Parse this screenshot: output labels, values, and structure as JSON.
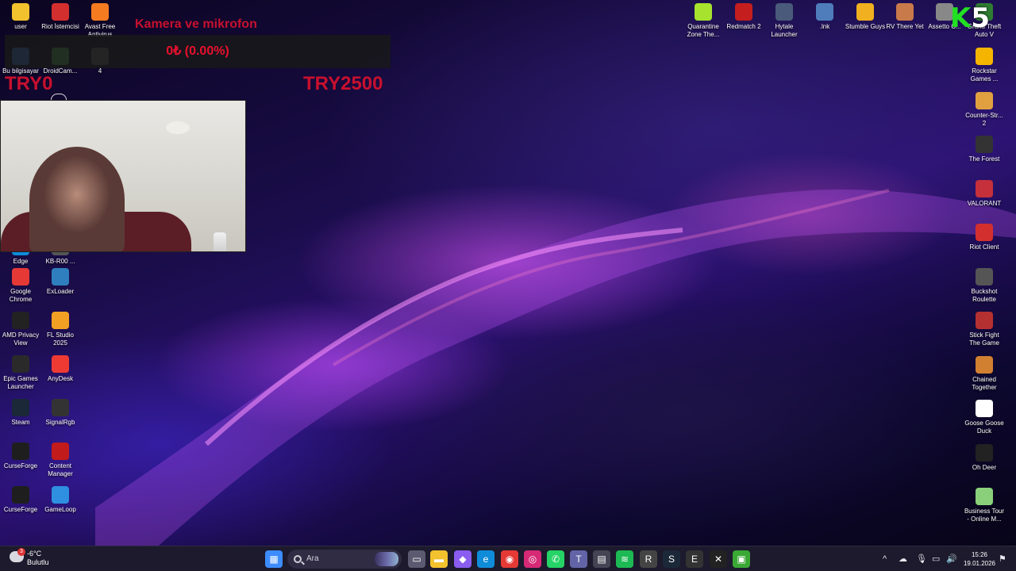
{
  "overlay": {
    "title": "Kamera ve mikrofon",
    "amount": "0₺ (0.00%)",
    "left_value": "TRY0",
    "right_value": "TRY2500"
  },
  "brand_badge": {
    "k": "K",
    "n": "5"
  },
  "desktop_left": [
    {
      "label": "user",
      "icon": "folder-icon",
      "color": "#f2c12e"
    },
    {
      "label": "Riot İstemcisi",
      "icon": "riot-icon",
      "color": "#d32f2f"
    },
    {
      "label": "Avast Free Antivirus",
      "icon": "avast-icon",
      "color": "#f47b20"
    },
    {
      "label": "Bu bilgisayar",
      "icon": "computer-icon",
      "color": "#3a7bd5"
    },
    {
      "label": "DroidCam...",
      "icon": "droidcam-icon",
      "color": "#4caf50"
    },
    {
      "label": "4",
      "icon": "unknown-icon",
      "color": "#666666"
    },
    {
      "label": "Edge",
      "icon": "edge-icon",
      "color": "#0f8cd9"
    },
    {
      "label": "KB-R00 ...",
      "icon": "app-icon",
      "color": "#555555"
    },
    {
      "label": "Google Chrome",
      "icon": "chrome-icon",
      "color": "#e53935"
    },
    {
      "label": "ExLoader",
      "icon": "exloader-icon",
      "color": "#2f7fbf"
    },
    {
      "label": "AMD Privacy View",
      "icon": "amd-icon",
      "color": "#222222"
    },
    {
      "label": "FL Studio 2025",
      "icon": "flstudio-icon",
      "color": "#f2a024"
    },
    {
      "label": "Epic Games Launcher",
      "icon": "epic-icon",
      "color": "#2a2a2a"
    },
    {
      "label": "AnyDesk",
      "icon": "anydesk-icon",
      "color": "#ef3a33"
    },
    {
      "label": "Steam",
      "icon": "steam-icon",
      "color": "#1b2838"
    },
    {
      "label": "SignalRgb",
      "icon": "signalrgb-icon",
      "color": "#333333"
    },
    {
      "label": "CurseForge",
      "icon": "curseforge-icon",
      "color": "#1e1e1e"
    },
    {
      "label": "Content Manager",
      "icon": "content-manager-icon",
      "color": "#c21b1b"
    },
    {
      "label": "CurseForge",
      "icon": "curseforge-icon",
      "color": "#1e1e1e"
    },
    {
      "label": "GameLoop",
      "icon": "gameloop-icon",
      "color": "#2f8fe0"
    }
  ],
  "desktop_top_right": [
    {
      "label": "Quarantine Zone The...",
      "icon": "quarantine-icon",
      "color": "#a6e22e"
    },
    {
      "label": "Redmatch 2",
      "icon": "redmatch-icon",
      "color": "#c41e1e"
    },
    {
      "label": "Hytale Launcher",
      "icon": "hytale-icon",
      "color": "#4a5a7a"
    },
    {
      "label": ".lnk",
      "icon": "shortcut-icon",
      "color": "#4f7dbb"
    },
    {
      "label": "Stumble Guys",
      "icon": "stumble-icon",
      "color": "#f0b020"
    },
    {
      "label": "RV There Yet",
      "icon": "rv-icon",
      "color": "#c87a4a"
    },
    {
      "label": "Assetto C...",
      "icon": "assetto-icon",
      "color": "#888888"
    },
    {
      "label": "Grand Theft Auto V",
      "icon": "gta-icon",
      "color": "#2e7d32"
    }
  ],
  "desktop_right": [
    {
      "label": "Rockstar Games ...",
      "icon": "rockstar-icon",
      "color": "#f5b400"
    },
    {
      "label": "Counter-Str... 2",
      "icon": "cs2-icon",
      "color": "#e0a040"
    },
    {
      "label": "The Forest",
      "icon": "forest-icon",
      "color": "#333333"
    },
    {
      "label": "VALORANT",
      "icon": "valorant-icon",
      "color": "#c5303b"
    },
    {
      "label": "Riot Client",
      "icon": "riot-icon",
      "color": "#d32f2f"
    },
    {
      "label": "Buckshot Roulette",
      "icon": "buckshot-icon",
      "color": "#555555"
    },
    {
      "label": "Stick Fight The Game",
      "icon": "stickfight-icon",
      "color": "#b53030"
    },
    {
      "label": "Chained Together",
      "icon": "chained-icon",
      "color": "#d08030"
    },
    {
      "label": "Goose Goose Duck",
      "icon": "goose-icon",
      "color": "#ffffff"
    },
    {
      "label": "Oh Deer",
      "icon": "deer-icon",
      "color": "#222222"
    },
    {
      "label": "Business Tour - Online M...",
      "icon": "business-tour-icon",
      "color": "#8ad07a"
    }
  ],
  "taskbar": {
    "weather_temp": "-6°C",
    "weather_desc": "Bulutlu",
    "weather_badge": "3",
    "search_placeholder": "Ara",
    "apps": [
      {
        "icon": "windows-start-icon",
        "glyph": "▦",
        "color": "#3d8cff"
      },
      {
        "icon": "task-view-icon",
        "glyph": "▭",
        "color": "#5a5a70"
      },
      {
        "icon": "file-explorer-icon",
        "glyph": "▬",
        "color": "#f2c12e"
      },
      {
        "icon": "copilot-icon",
        "glyph": "◆",
        "color": "#8a5cf0"
      },
      {
        "icon": "edge-icon",
        "glyph": "e",
        "color": "#0f8cd9"
      },
      {
        "icon": "chrome-icon",
        "glyph": "◉",
        "color": "#e53935"
      },
      {
        "icon": "instagram-icon",
        "glyph": "◎",
        "color": "#d62976"
      },
      {
        "icon": "whatsapp-icon",
        "glyph": "✆",
        "color": "#25d366"
      },
      {
        "icon": "teams-icon",
        "glyph": "T",
        "color": "#6264a7"
      },
      {
        "icon": "store-icon",
        "glyph": "▤",
        "color": "#444455"
      },
      {
        "icon": "spotify-icon",
        "glyph": "≋",
        "color": "#1db954"
      },
      {
        "icon": "riot-icon",
        "glyph": "R",
        "color": "#444444"
      },
      {
        "icon": "steam-icon",
        "glyph": "S",
        "color": "#1b2838"
      },
      {
        "icon": "epic-icon",
        "glyph": "E",
        "color": "#333333"
      },
      {
        "icon": "curseforge-icon",
        "glyph": "✕",
        "color": "#222222"
      },
      {
        "icon": "android-icon",
        "glyph": "▣",
        "color": "#3aa835"
      }
    ],
    "tray": [
      "^",
      "☁",
      "🎙",
      "▭",
      "🔊"
    ],
    "time": "15:26",
    "date": "19.01.2026"
  }
}
